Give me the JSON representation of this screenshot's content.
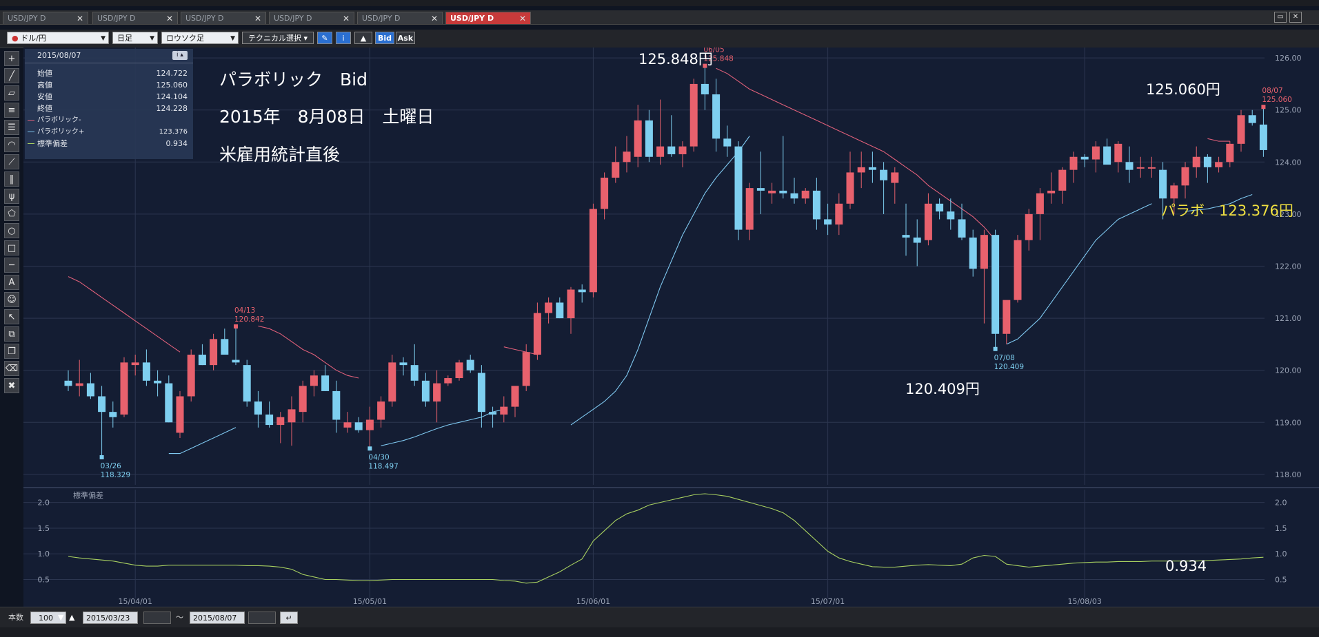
{
  "tabs": [
    {
      "label": "USD/JPY D",
      "active": false
    },
    {
      "label": "USD/JPY D",
      "active": false
    },
    {
      "label": "USD/JPY D",
      "active": false
    },
    {
      "label": "USD/JPY D",
      "active": false
    },
    {
      "label": "USD/JPY D",
      "active": false
    },
    {
      "label": "USD/JPY D",
      "active": true
    }
  ],
  "toolbar": {
    "pair": "ドル/円",
    "period": "日足",
    "chart_type": "ロウソク足",
    "technical": "テクニカル選択",
    "bid": "Bid",
    "ask": "Ask"
  },
  "infobox": {
    "date": "2015/08/07",
    "rows": [
      {
        "label": "始値",
        "value": "124.722"
      },
      {
        "label": "高値",
        "value": "125.060"
      },
      {
        "label": "安値",
        "value": "124.104"
      },
      {
        "label": "終値",
        "value": "124.228"
      }
    ],
    "legend": [
      {
        "label": "パラボリック-",
        "value": "",
        "color": "#e0607a"
      },
      {
        "label": "パラボリック+",
        "value": "123.376",
        "color": "#7fc8f0"
      },
      {
        "label": "標準偏差",
        "value": "0.934",
        "color": "#a8d060"
      }
    ]
  },
  "annotations": {
    "line1": "パラボリック　Bid",
    "line2": "2015年　8月08日　土曜日",
    "line3": "米雇用統計直後",
    "high_label": "125.848円",
    "last_high_label": "125.060円",
    "low_label": "120.409円",
    "parabo_label": "パラボ　123.376円",
    "stdev_label": "0.934"
  },
  "chart_data": [
    {
      "type": "candlestick",
      "ylim": [
        117.8,
        126.2
      ],
      "yticks": [
        "118.00",
        "119.00",
        "120.00",
        "121.00",
        "122.00",
        "123.00",
        "124.00",
        "125.00",
        "126.00"
      ],
      "xticks": [
        {
          "label": "15/04/01",
          "index": 6
        },
        {
          "label": "15/05/01",
          "index": 27
        },
        {
          "label": "15/06/01",
          "index": 47
        },
        {
          "label": "15/07/01",
          "index": 68
        },
        {
          "label": "15/08/03",
          "index": 91
        }
      ],
      "candles": [
        [
          119.8,
          120.0,
          119.6,
          119.7
        ],
        [
          119.7,
          120.2,
          119.5,
          119.75
        ],
        [
          119.75,
          119.95,
          119.45,
          119.5
        ],
        [
          119.5,
          119.7,
          118.33,
          119.2
        ],
        [
          119.2,
          119.4,
          118.9,
          119.1
        ],
        [
          119.15,
          120.25,
          119.1,
          120.15
        ],
        [
          120.1,
          120.3,
          119.9,
          120.15
        ],
        [
          120.15,
          120.4,
          119.7,
          119.8
        ],
        [
          119.8,
          120.0,
          119.5,
          119.75
        ],
        [
          119.75,
          119.9,
          119.0,
          119.0
        ],
        [
          118.8,
          119.6,
          118.7,
          119.5
        ],
        [
          119.5,
          120.4,
          119.4,
          120.3
        ],
        [
          120.3,
          120.5,
          120.1,
          120.1
        ],
        [
          120.1,
          120.7,
          120.0,
          120.6
        ],
        [
          120.6,
          120.8,
          120.3,
          120.3
        ],
        [
          120.2,
          120.84,
          120.1,
          120.15
        ],
        [
          120.1,
          120.2,
          119.3,
          119.4
        ],
        [
          119.4,
          119.6,
          118.9,
          119.15
        ],
        [
          119.15,
          119.4,
          118.9,
          118.95
        ],
        [
          118.95,
          119.2,
          118.6,
          119.1
        ],
        [
          119.0,
          119.5,
          118.55,
          119.25
        ],
        [
          119.2,
          119.8,
          119.0,
          119.7
        ],
        [
          119.7,
          120.0,
          119.5,
          119.9
        ],
        [
          119.9,
          120.1,
          119.6,
          119.6
        ],
        [
          119.6,
          119.8,
          118.8,
          119.05
        ],
        [
          118.9,
          119.2,
          118.8,
          119.0
        ],
        [
          119.0,
          119.1,
          118.8,
          118.85
        ],
        [
          118.85,
          119.3,
          118.5,
          119.05
        ],
        [
          119.05,
          119.5,
          118.9,
          119.4
        ],
        [
          119.4,
          120.3,
          119.3,
          120.15
        ],
        [
          120.15,
          120.25,
          119.9,
          120.1
        ],
        [
          120.1,
          120.5,
          119.7,
          119.8
        ],
        [
          119.8,
          119.95,
          119.3,
          119.4
        ],
        [
          119.4,
          120.0,
          119.0,
          119.75
        ],
        [
          119.75,
          119.9,
          119.7,
          119.85
        ],
        [
          119.85,
          120.2,
          119.8,
          120.15
        ],
        [
          120.2,
          120.3,
          119.95,
          120.0
        ],
        [
          119.95,
          120.1,
          118.9,
          119.2
        ],
        [
          119.2,
          119.3,
          118.9,
          119.15
        ],
        [
          119.15,
          119.5,
          119.0,
          119.3
        ],
        [
          119.3,
          119.6,
          119.1,
          119.7
        ],
        [
          119.7,
          120.5,
          119.6,
          120.35
        ],
        [
          120.3,
          121.3,
          120.2,
          121.1
        ],
        [
          121.1,
          121.4,
          120.9,
          121.3
        ],
        [
          121.3,
          121.4,
          121.0,
          121.0
        ],
        [
          121.0,
          121.6,
          120.7,
          121.55
        ],
        [
          121.55,
          121.65,
          121.3,
          121.5
        ],
        [
          121.5,
          123.2,
          121.4,
          123.1
        ],
        [
          123.1,
          123.8,
          122.9,
          123.7
        ],
        [
          123.7,
          124.3,
          123.6,
          124.0
        ],
        [
          124.0,
          124.5,
          123.8,
          124.2
        ],
        [
          124.1,
          125.1,
          123.9,
          124.8
        ],
        [
          124.8,
          125.0,
          124.0,
          124.1
        ],
        [
          124.1,
          125.2,
          123.95,
          124.3
        ],
        [
          124.3,
          124.9,
          124.1,
          124.15
        ],
        [
          124.15,
          124.4,
          123.9,
          124.3
        ],
        [
          124.3,
          125.6,
          124.2,
          125.5
        ],
        [
          125.5,
          125.85,
          125.0,
          125.3
        ],
        [
          125.3,
          125.6,
          124.2,
          124.45
        ],
        [
          124.45,
          124.7,
          124.1,
          124.3
        ],
        [
          124.3,
          124.4,
          122.5,
          122.7
        ],
        [
          122.7,
          123.6,
          122.5,
          123.5
        ],
        [
          123.5,
          124.2,
          123.0,
          123.45
        ],
        [
          123.4,
          123.6,
          123.2,
          123.45
        ],
        [
          123.45,
          124.5,
          123.3,
          123.4
        ],
        [
          123.4,
          123.7,
          123.2,
          123.3
        ],
        [
          123.3,
          123.5,
          123.2,
          123.45
        ],
        [
          123.45,
          123.7,
          122.7,
          122.9
        ],
        [
          122.9,
          123.2,
          122.6,
          122.8
        ],
        [
          122.8,
          123.4,
          122.6,
          123.2
        ],
        [
          123.2,
          124.2,
          123.1,
          123.8
        ],
        [
          123.8,
          124.2,
          123.5,
          123.9
        ],
        [
          123.9,
          124.2,
          123.6,
          123.85
        ],
        [
          123.85,
          124.0,
          123.0,
          123.65
        ],
        [
          123.6,
          123.9,
          123.2,
          123.8
        ],
        [
          122.6,
          123.2,
          122.2,
          122.55
        ],
        [
          122.55,
          122.9,
          122.0,
          122.45
        ],
        [
          122.5,
          123.4,
          122.4,
          123.2
        ],
        [
          123.2,
          123.3,
          122.9,
          123.05
        ],
        [
          123.05,
          123.3,
          122.7,
          122.9
        ],
        [
          122.9,
          123.2,
          122.5,
          122.55
        ],
        [
          122.55,
          122.7,
          121.8,
          121.95
        ],
        [
          121.95,
          122.7,
          120.9,
          122.6
        ],
        [
          122.6,
          122.7,
          120.41,
          120.7
        ],
        [
          120.7,
          121.2,
          120.5,
          121.35
        ],
        [
          121.35,
          122.6,
          121.3,
          122.5
        ],
        [
          122.5,
          123.1,
          122.3,
          123.0
        ],
        [
          123.0,
          123.5,
          122.5,
          123.4
        ],
        [
          123.4,
          123.8,
          123.2,
          123.45
        ],
        [
          123.45,
          123.9,
          123.2,
          123.85
        ],
        [
          123.85,
          124.2,
          123.6,
          124.1
        ],
        [
          124.1,
          124.15,
          123.9,
          124.05
        ],
        [
          124.05,
          124.4,
          123.8,
          124.3
        ],
        [
          124.3,
          124.45,
          124.0,
          123.95
        ],
        [
          124.0,
          124.4,
          123.8,
          124.35
        ],
        [
          124.0,
          124.3,
          123.6,
          123.85
        ],
        [
          123.9,
          124.1,
          123.7,
          123.9
        ],
        [
          123.9,
          124.1,
          123.7,
          123.9
        ],
        [
          123.85,
          124.0,
          122.9,
          123.3
        ],
        [
          123.3,
          123.6,
          123.0,
          123.55
        ],
        [
          123.55,
          124.0,
          123.3,
          123.9
        ],
        [
          123.9,
          124.3,
          123.7,
          124.1
        ],
        [
          124.1,
          124.15,
          123.6,
          123.9
        ],
        [
          123.9,
          124.1,
          123.8,
          124.0
        ],
        [
          124.0,
          124.4,
          123.9,
          124.35
        ],
        [
          124.35,
          125.0,
          124.2,
          124.9
        ],
        [
          124.9,
          125.0,
          124.7,
          124.75
        ],
        [
          124.72,
          125.06,
          124.1,
          124.23
        ]
      ],
      "markers": [
        {
          "date": "03/26",
          "value": "118.329",
          "index": 3,
          "price": 118.329,
          "kind": "low"
        },
        {
          "date": "04/13",
          "value": "120.842",
          "index": 15,
          "price": 120.842,
          "kind": "high"
        },
        {
          "date": "04/30",
          "value": "118.497",
          "index": 27,
          "price": 118.497,
          "kind": "low"
        },
        {
          "date": "06/05",
          "value": "125.848",
          "index": 57,
          "price": 125.848,
          "kind": "high"
        },
        {
          "date": "07/08",
          "value": "120.409",
          "index": 83,
          "price": 120.409,
          "kind": "low"
        },
        {
          "date": "08/07",
          "value": "125.060",
          "index": 107,
          "price": 125.06,
          "kind": "high"
        }
      ],
      "sar_minus": [
        {
          "from": 0,
          "values": [
            121.8,
            121.7,
            121.55,
            121.4,
            121.25,
            121.1,
            120.95,
            120.8,
            120.65,
            120.5,
            120.35
          ]
        },
        {
          "from": 17,
          "values": [
            120.85,
            120.8,
            120.7,
            120.55,
            120.4,
            120.3,
            120.15,
            120.0,
            119.9,
            119.85
          ]
        },
        {
          "from": 39,
          "values": [
            120.45,
            120.4,
            120.35,
            120.3
          ]
        },
        {
          "from": 58,
          "values": [
            125.8,
            125.7,
            125.55,
            125.4,
            125.3,
            125.2,
            125.1,
            125.0,
            124.9,
            124.8,
            124.7,
            124.6,
            124.5,
            124.4,
            124.3,
            124.2,
            124.05,
            123.9,
            123.75,
            123.55,
            123.4,
            123.25,
            123.1,
            122.95,
            122.75,
            122.5
          ]
        },
        {
          "from": 102,
          "values": [
            124.45,
            124.4,
            124.4
          ]
        }
      ],
      "sar_plus": [
        {
          "from": 9,
          "values": [
            118.4,
            118.4,
            118.5,
            118.6,
            118.7,
            118.8,
            118.9
          ]
        },
        {
          "from": 28,
          "values": [
            118.55,
            118.6,
            118.65,
            118.72,
            118.8,
            118.88,
            118.95,
            119.0,
            119.05,
            119.1,
            119.2,
            119.25
          ]
        },
        {
          "from": 45,
          "values": [
            118.95,
            119.1,
            119.25,
            119.4,
            119.6,
            119.9,
            120.4,
            121.0,
            121.6,
            122.1,
            122.6,
            123.0,
            123.4,
            123.7,
            123.95,
            124.2,
            124.5
          ]
        },
        {
          "from": 84,
          "values": [
            120.5,
            120.6,
            120.8,
            121.0,
            121.3,
            121.6,
            121.9,
            122.2,
            122.5,
            122.7,
            122.9,
            123.0,
            123.1,
            123.2
          ]
        },
        {
          "from": 100,
          "values": [
            123.05,
            123.08,
            123.1,
            123.15,
            123.2,
            123.3,
            123.376
          ]
        }
      ]
    },
    {
      "type": "line",
      "title": "標準偏差",
      "ylim": [
        0.4,
        2.25
      ],
      "yticks": [
        "0.5",
        "1.0",
        "1.5",
        "2.0"
      ],
      "series": [
        {
          "from": 0,
          "values": [
            0.95,
            0.92,
            0.9,
            0.88,
            0.86,
            0.82,
            0.78,
            0.76,
            0.76,
            0.78,
            0.78,
            0.78,
            0.78,
            0.78,
            0.78,
            0.78,
            0.77,
            0.77,
            0.76,
            0.74,
            0.7,
            0.6,
            0.55,
            0.5,
            0.5,
            0.49,
            0.48,
            0.48,
            0.49,
            0.5,
            0.5,
            0.5,
            0.5,
            0.5,
            0.5,
            0.5,
            0.5,
            0.5,
            0.5,
            0.48,
            0.47,
            0.43,
            0.45,
            0.55,
            0.65,
            0.78,
            0.9,
            1.25,
            1.45,
            1.65,
            1.78,
            1.85,
            1.95,
            2.0,
            2.05,
            2.1,
            2.15,
            2.17,
            2.15,
            2.12,
            2.06,
            2.0,
            1.94,
            1.88,
            1.8,
            1.65,
            1.45,
            1.25,
            1.05,
            0.92,
            0.85,
            0.8,
            0.75,
            0.74,
            0.74,
            0.76,
            0.78,
            0.79,
            0.78,
            0.77,
            0.8,
            0.92,
            0.97,
            0.95,
            0.8,
            0.77,
            0.74,
            0.76,
            0.78,
            0.8,
            0.82,
            0.83,
            0.84,
            0.84,
            0.85,
            0.85,
            0.85,
            0.86,
            0.86,
            0.86,
            0.86,
            0.86,
            0.87,
            0.88,
            0.89,
            0.9,
            0.92,
            0.934
          ]
        }
      ]
    }
  ],
  "colors": {
    "up": "#e8616d",
    "down": "#7ecff0",
    "sar_minus": "#e0607a",
    "sar_plus": "#7fc8f0",
    "stdev": "#a8d060",
    "annotation_yellow": "#f0e040"
  },
  "bottombar": {
    "count_label": "本数",
    "count_value": "100",
    "date_from": "2015/03/23",
    "tilde": "～",
    "date_to": "2015/08/07"
  }
}
